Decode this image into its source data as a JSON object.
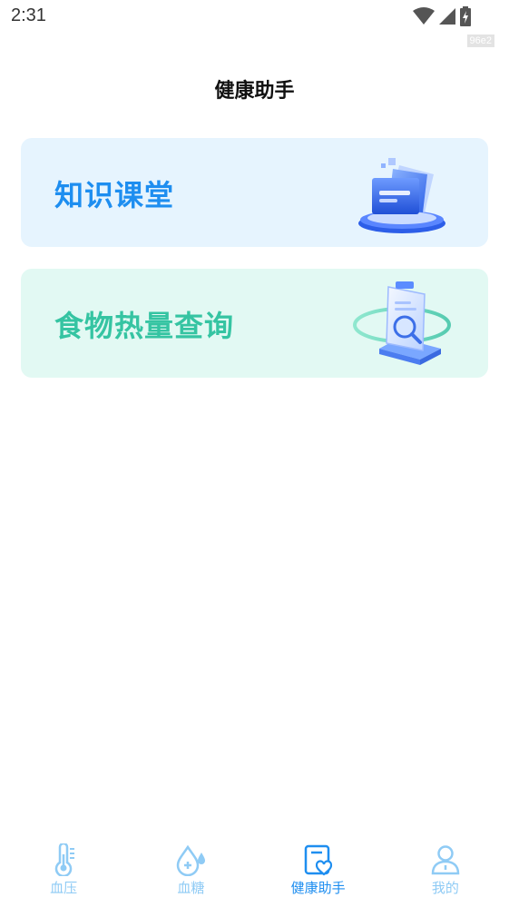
{
  "status_bar": {
    "time": "2:31",
    "build_tag": "96e2"
  },
  "header": {
    "title": "健康助手"
  },
  "cards": [
    {
      "label": "知识课堂",
      "icon": "folder-documents-icon",
      "color": "#1e8ef0",
      "background": "#e6f4fe"
    },
    {
      "label": "食物热量查询",
      "icon": "document-search-icon",
      "color": "#35c4a2",
      "background": "#e2f9f3"
    }
  ],
  "bottom_nav": {
    "active_color": "#1e8ef0",
    "inactive_color": "#8fcbf5",
    "items": [
      {
        "label": "血压",
        "icon": "thermometer-icon",
        "active": false
      },
      {
        "label": "血糖",
        "icon": "blood-drop-icon",
        "active": false
      },
      {
        "label": "健康助手",
        "icon": "heart-document-icon",
        "active": true
      },
      {
        "label": "我的",
        "icon": "user-icon",
        "active": false
      }
    ]
  }
}
